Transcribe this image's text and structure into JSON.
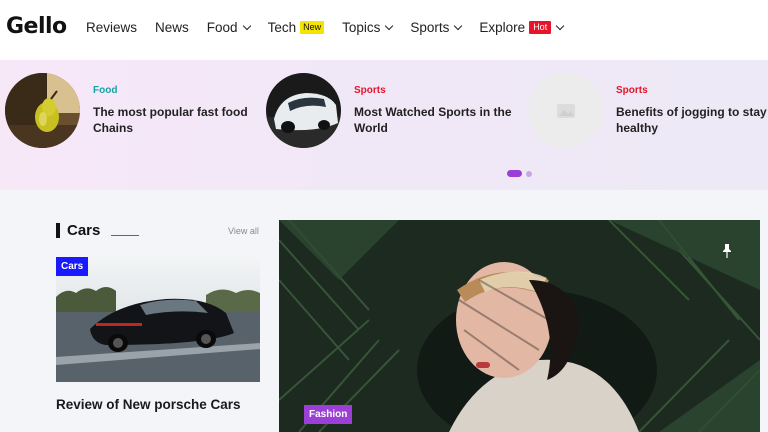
{
  "header": {
    "logo": "Gello",
    "nav": [
      {
        "label": "Reviews"
      },
      {
        "label": "News"
      },
      {
        "label": "Food",
        "dropdown": true
      },
      {
        "label": "Tech",
        "badge": "New"
      },
      {
        "label": "Topics",
        "dropdown": true
      },
      {
        "label": "Sports",
        "dropdown": true
      },
      {
        "label": "Explore",
        "badge": "Hot",
        "dropdown": true
      }
    ]
  },
  "slider": {
    "slides": [
      {
        "category": "Food",
        "category_color": "#17a2a2",
        "title": "The most popular fast food Chains"
      },
      {
        "category": "Sports",
        "category_color": "#e8142a",
        "title": "Most Watched Sports in the World"
      },
      {
        "category": "Sports",
        "category_color": "#e8142a",
        "title": "Benefits of jogging to stay healthy"
      }
    ],
    "active_index": 0,
    "page_count": 2
  },
  "cars_section": {
    "title": "Cars",
    "view_all": "View all",
    "card": {
      "tag": "Cars",
      "tag_color": "#1a1aff",
      "title": "Review of New porsche Cars"
    }
  },
  "feature": {
    "tag": "Fashion",
    "tag_color": "#9b3fd6",
    "pin_icon": "pin-icon"
  }
}
